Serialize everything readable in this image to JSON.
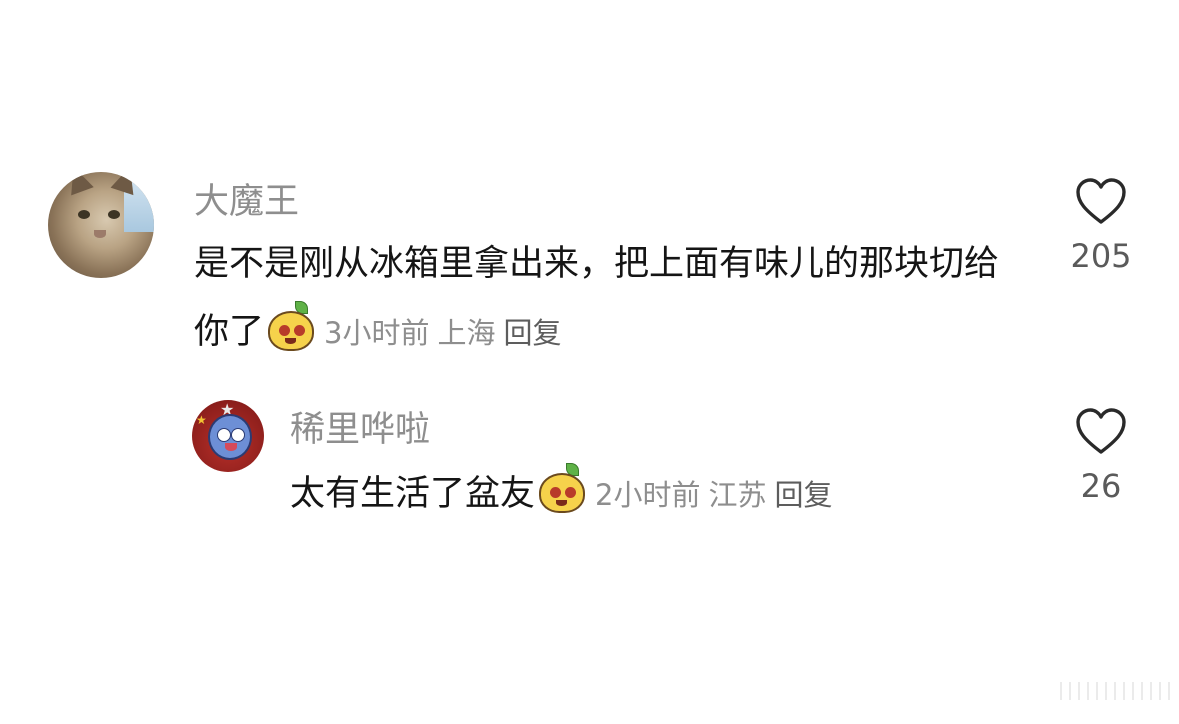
{
  "comments": [
    {
      "username": "大魔王",
      "text": "是不是刚从冰箱里拿出来，把上面有味儿的那块切给你了",
      "emoji": "yellow-face-emoji",
      "time": "3小时前",
      "location": "上海",
      "reply_label": "回复",
      "likes": "205",
      "avatar": "cat-photo-avatar"
    },
    {
      "username": "稀里哗啦",
      "text": "太有生活了盆友",
      "emoji": "yellow-face-emoji",
      "time": "2小时前",
      "location": "江苏",
      "reply_label": "回复",
      "likes": "26",
      "avatar": "cartoon-character-avatar"
    }
  ],
  "icons": {
    "like": "heart-outline-icon"
  },
  "colors": {
    "username": "#8e8e8e",
    "text": "#151515",
    "meta": "#8e8e8e",
    "reply": "#5d5d5d",
    "like_count": "#5a5a5a",
    "background": "#ffffff"
  }
}
